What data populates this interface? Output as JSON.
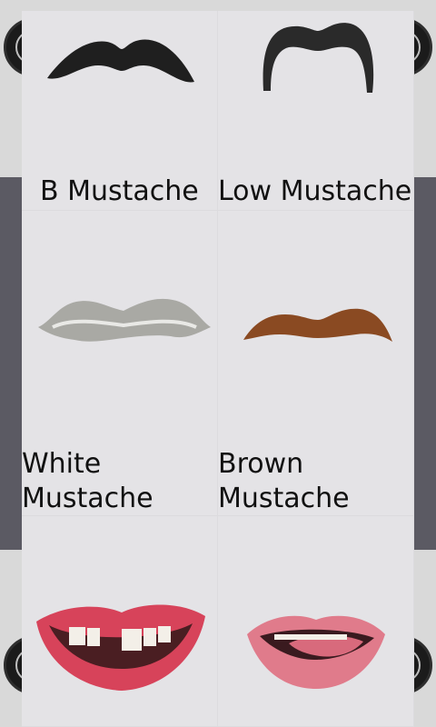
{
  "items": [
    {
      "label": "B Mustache"
    },
    {
      "label": "Low Mustache"
    },
    {
      "label": "White\nMustache"
    },
    {
      "label": "Brown\nMustache"
    },
    {
      "label": ""
    },
    {
      "label": ""
    }
  ],
  "colors": {
    "black_mustache": "#1f1f1f",
    "white_mustache": "#a9a9a4",
    "brown_mustache": "#8a4a22",
    "lips": "#d7435a"
  }
}
